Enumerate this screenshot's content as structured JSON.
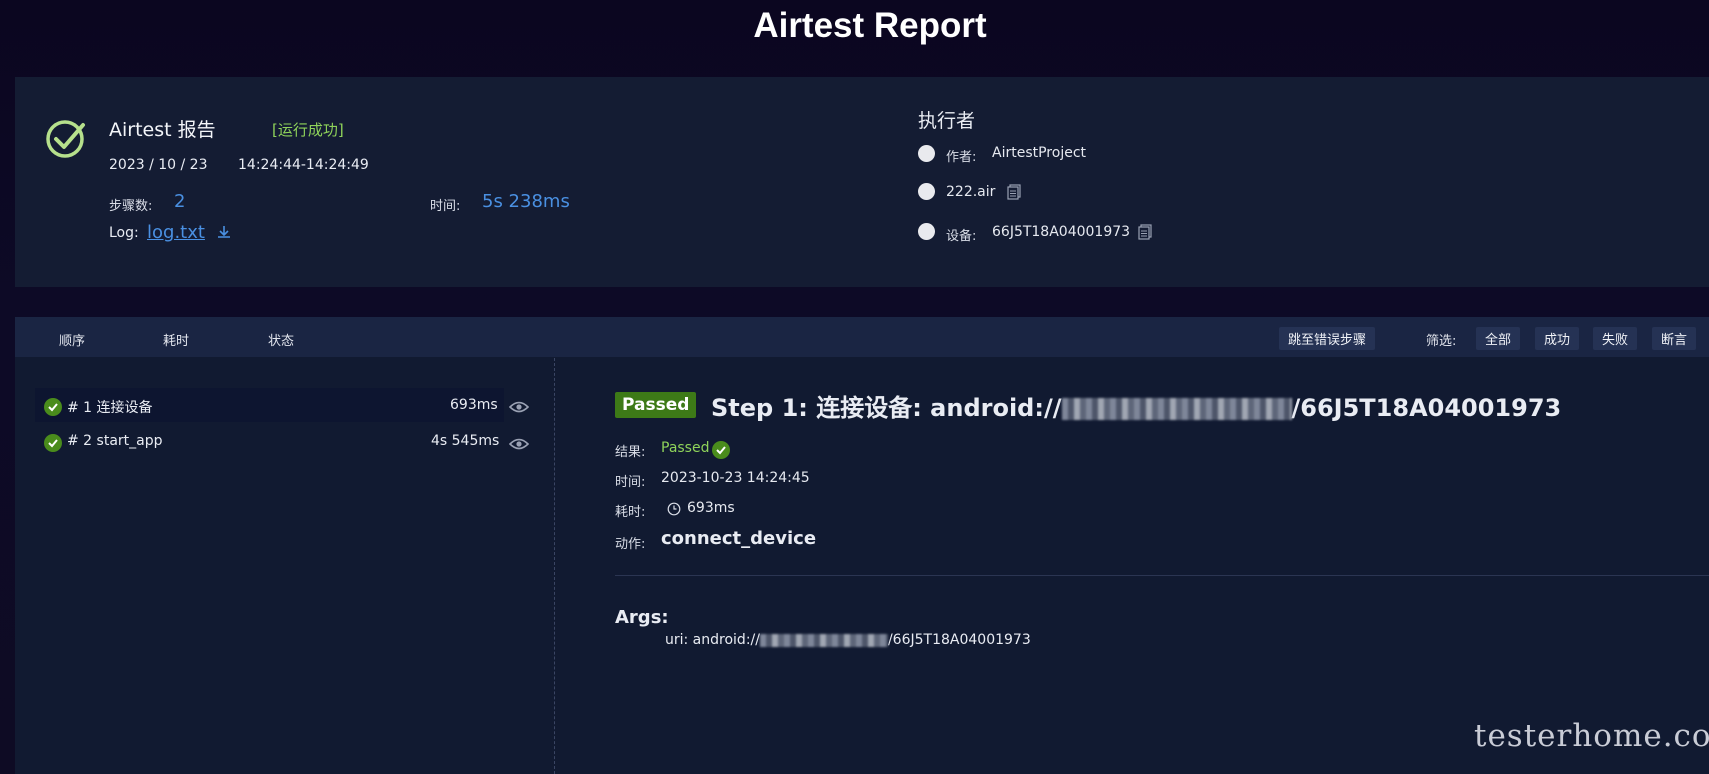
{
  "header": {
    "title": "Airtest Report"
  },
  "summary": {
    "report_title": "Airtest 报告",
    "run_status": "[运行成功]",
    "date": "2023 / 10 / 23",
    "time_range": "14:24:44-14:24:49",
    "steps_label": "步骤数:",
    "steps_value": "2",
    "duration_label": "时间:",
    "duration_value": "5s 238ms",
    "log_label": "Log:",
    "log_link": "log.txt"
  },
  "executor": {
    "heading": "执行者",
    "author_label": "作者:",
    "author_value": "AirtestProject",
    "script_name": "222.air",
    "device_label": "设备:",
    "device_value": "66J5T18A04001973"
  },
  "toolbar": {
    "sort_order": "顺序",
    "sort_time": "耗时",
    "sort_status": "状态",
    "jump_error": "跳至错误步骤",
    "filter_label": "筛选:",
    "filters": [
      "全部",
      "成功",
      "失败",
      "断言"
    ]
  },
  "steps": [
    {
      "label": "# 1 连接设备",
      "time": "693ms"
    },
    {
      "label": "# 2 start_app",
      "time": "4s 545ms"
    }
  ],
  "detail": {
    "badge": "Passed",
    "title_prefix": "Step 1: 连接设备: android://",
    "title_suffix": "/66J5T18A04001973",
    "result_label": "结果:",
    "result_value": "Passed",
    "time_label": "时间:",
    "time_value": "2023-10-23 14:24:45",
    "cost_label": "耗时:",
    "cost_value": "693ms",
    "action_label": "动作:",
    "action_value": "connect_device",
    "args_heading": "Args:",
    "arg_prefix": "uri: android://",
    "arg_suffix": "/66J5T18A04001973"
  },
  "watermark": "testerhome.com",
  "colors": {
    "accent_blue": "#4a90e2",
    "success_green": "#4a8c1c",
    "status_text_green": "#8fd35a",
    "panel_bg": "#141c33"
  }
}
